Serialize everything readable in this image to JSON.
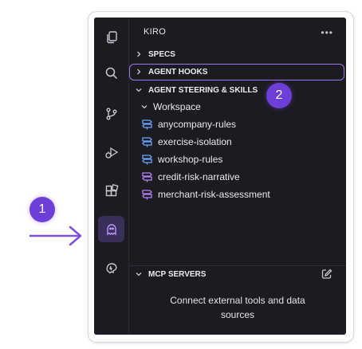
{
  "explorer": {
    "title": "KIRO",
    "more_icon": "more-horizontal-icon"
  },
  "activity_bar": {
    "items": [
      {
        "icon": "files-icon"
      },
      {
        "icon": "search-icon"
      },
      {
        "icon": "source-control-icon"
      },
      {
        "icon": "run-debug-icon"
      },
      {
        "icon": "extensions-icon"
      },
      {
        "icon": "kiro-ghost-icon",
        "active": true
      },
      {
        "icon": "kiro-alt-icon"
      }
    ]
  },
  "sections": {
    "specs": "SPECS",
    "hooks": "AGENT HOOKS",
    "steering": "AGENT STEERING & SKILLS",
    "mcp": "MCP SERVERS"
  },
  "steering": {
    "workspace_label": "Workspace",
    "items": [
      {
        "label": "anycompany-rules",
        "icon_color": "#6aa8ff"
      },
      {
        "label": "exercise-isolation",
        "icon_color": "#6aa8ff"
      },
      {
        "label": "workshop-rules",
        "icon_color": "#6aa8ff"
      },
      {
        "label": "credit-risk-narrative",
        "icon_color": "#b583f5"
      },
      {
        "label": "merchant-risk-assessment",
        "icon_color": "#b583f5"
      }
    ]
  },
  "mcp": {
    "message": "Connect external tools and data sources"
  },
  "callouts": {
    "badge1": "1",
    "badge2": "2"
  },
  "colors": {
    "accent": "#9a78e6",
    "badge": "#6c3fd9",
    "background": "#1c1b22"
  }
}
